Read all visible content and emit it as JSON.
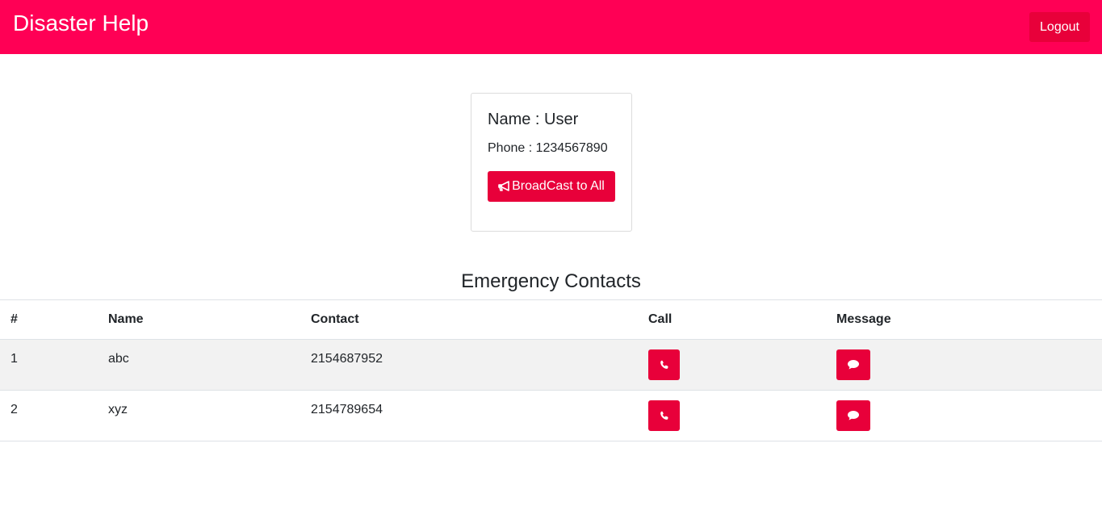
{
  "navbar": {
    "brand": "Disaster Help",
    "logout_label": "Logout"
  },
  "profile": {
    "name_text": "Name : User",
    "phone_text": "Phone : 1234567890",
    "broadcast_label": "BroadCast to All",
    "broadcast_icon": "bullhorn-icon"
  },
  "contacts": {
    "title": "Emergency Contacts",
    "headers": [
      "#",
      "Name",
      "Contact",
      "Call",
      "Message"
    ],
    "rows": [
      {
        "num": "1",
        "name": "abc",
        "contact": "2154687952"
      },
      {
        "num": "2",
        "name": "xyz",
        "contact": "2154789654"
      }
    ],
    "call_icon": "phone-icon",
    "message_icon": "comment-icon"
  },
  "colors": {
    "navbar_bg": "#ff0055",
    "button_bg": "#e8003a",
    "stripe_bg": "#f2f2f2"
  }
}
